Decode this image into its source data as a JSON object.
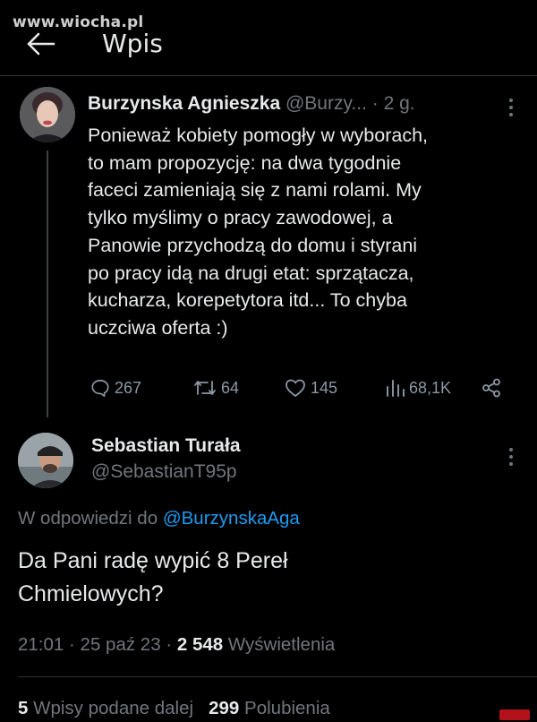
{
  "watermark": "www.wiocha.pl",
  "header": {
    "title": "Wpis",
    "back_icon": "arrow-left-icon"
  },
  "quoted_tweet": {
    "author_name": "Burzynska Agnieszka",
    "author_handle": "@Burzy...",
    "time": "· 2 g.",
    "text_lines": [
      "Ponieważ kobiety pomogły w wyborach,",
      "to mam propozycję: na dwa tygodnie",
      "faceci zamieniają się z nami rolami. My",
      "tylko myślimy o pracy zawodowej, a",
      "Panowie przychodzą do domu i styrani",
      "po pracy idą na drugi etat: sprzątacza,",
      "kucharza, korepetytora itd... To chyba",
      "uczciwa oferta :)"
    ],
    "actions": {
      "replies": "267",
      "retweets": "64",
      "likes": "145",
      "views": "68,1K"
    }
  },
  "main_tweet": {
    "author_name": "Sebastian Turała",
    "author_handle": "@SebastianT95p",
    "reply_prefix": "W odpowiedzi do",
    "reply_handle": "@BurzynskaAga",
    "text_lines": [
      "Da Pani radę wypić 8 Pereł",
      "Chmielowych?"
    ],
    "time": "21:01",
    "date": "25 paź 23",
    "views_count": "2 548",
    "views_label": "Wyświetlenia",
    "retweets_count": "5",
    "retweets_label": "Wpisy podane dalej",
    "likes_count": "299",
    "likes_label": "Polubienia"
  },
  "colors": {
    "background": "#000000",
    "text": "#e7e9ea",
    "secondary": "#71767b",
    "link": "#1d9bf0",
    "divider": "#2f3336"
  }
}
